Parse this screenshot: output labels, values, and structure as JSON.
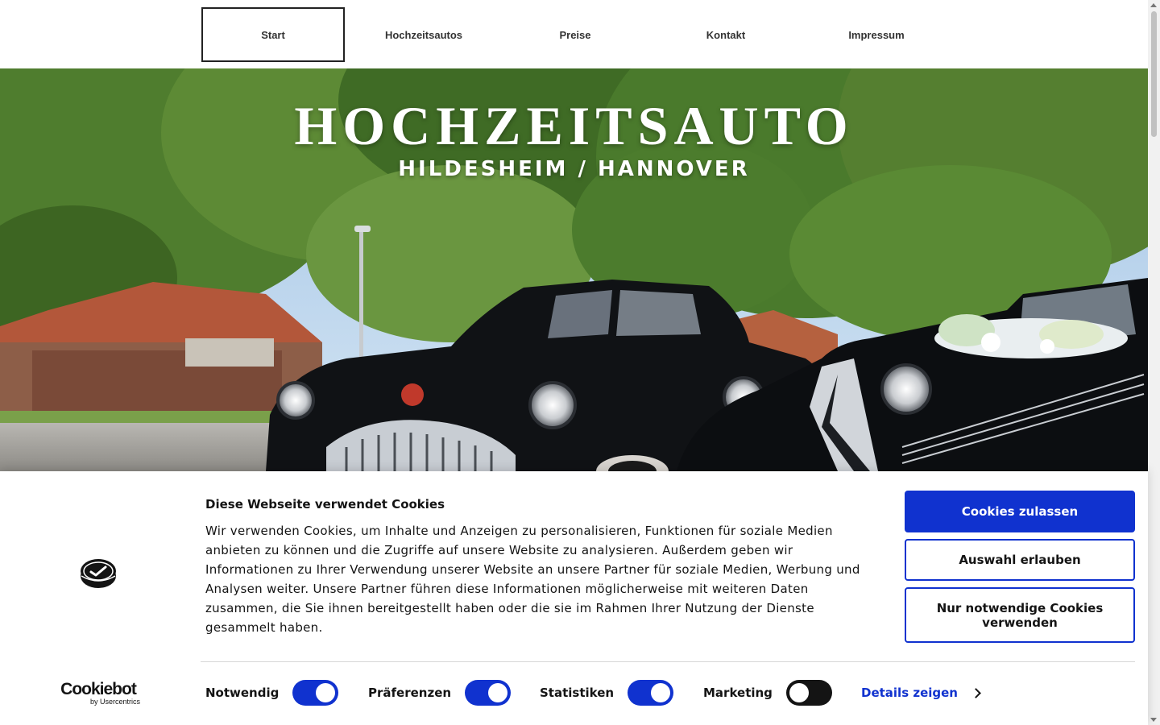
{
  "nav": {
    "items": [
      {
        "label": "Start",
        "active": true
      },
      {
        "label": "Hochzeitsautos",
        "active": false
      },
      {
        "label": "Preise",
        "active": false
      },
      {
        "label": "Kontakt",
        "active": false
      },
      {
        "label": "Impressum",
        "active": false
      }
    ]
  },
  "hero": {
    "title": "HOCHZEITSAUTO",
    "subtitle": "HILDESHEIM / HANNOVER",
    "image_icon": "vintage-wedding-cars-photo"
  },
  "cookie_banner": {
    "title": "Diese Webseite verwendet Cookies",
    "text": "Wir verwenden Cookies, um Inhalte und Anzeigen zu personalisieren, Funktionen für soziale Medien anbieten zu können und die Zugriffe auf unsere Website zu analysieren. Außerdem geben wir Informationen zu Ihrer Verwendung unserer Website an unsere Partner für soziale Medien, Werbung und Analysen weiter. Unsere Partner führen diese Informationen möglicherweise mit weiteren Daten zusammen, die Sie ihnen bereitgestellt haben oder die sie im Rahmen Ihrer Nutzung der Dienste gesammelt haben.",
    "buttons": {
      "allow_all": "Cookies zulassen",
      "allow_selection": "Auswahl erlauben",
      "necessary_only": "Nur notwendige Cookies verwenden"
    },
    "brand": {
      "name": "Cookiebot",
      "sub": "by Usercentrics"
    },
    "toggles": [
      {
        "label": "Notwendig",
        "checked": true
      },
      {
        "label": "Präferenzen",
        "checked": true
      },
      {
        "label": "Statistiken",
        "checked": true
      },
      {
        "label": "Marketing",
        "checked": false
      }
    ],
    "details_link": "Details zeigen"
  },
  "colors": {
    "accent": "#1032cf",
    "text": "#141414",
    "toggle_off": "#141414"
  }
}
